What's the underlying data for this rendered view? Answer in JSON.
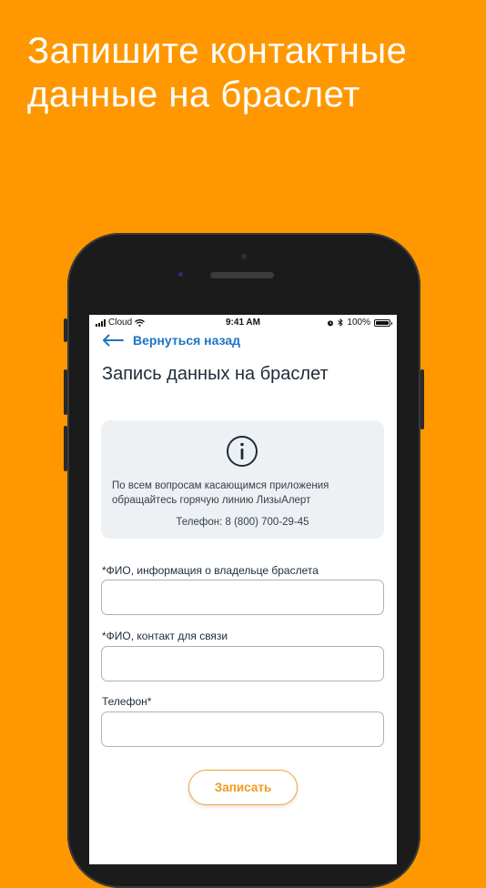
{
  "promo": {
    "headline_line1": "Запишите контактные",
    "headline_line2": "данные на браслет"
  },
  "colors": {
    "background": "#ff9800",
    "accent_blue": "#1e74c6",
    "button_orange": "#f29a1f",
    "card_bg": "#eef1f4"
  },
  "status_bar": {
    "carrier": "Cloud",
    "time": "9:41 AM",
    "battery": "100%",
    "icons": [
      "signal-icon",
      "wifi-icon",
      "alarm-icon",
      "bluetooth-icon",
      "battery-icon"
    ]
  },
  "nav": {
    "back_label": "Вернуться назад",
    "back_icon": "arrow-left-icon"
  },
  "page": {
    "title": "Запись данных на браслет"
  },
  "info": {
    "icon": "info-icon",
    "line1": "По всем вопросам касающимся приложения",
    "line2": "обращайтесь горячую линию ЛизыАлерт",
    "phone": "Телефон: 8 (800) 700-29-45"
  },
  "form": {
    "owner_label": "*ФИО, информация о владельце браслета",
    "owner_value": "",
    "contact_label": "*ФИО, контакт для связи",
    "contact_value": "",
    "phone_label": "Телефон*",
    "phone_value": "",
    "submit_label": "Записать"
  }
}
